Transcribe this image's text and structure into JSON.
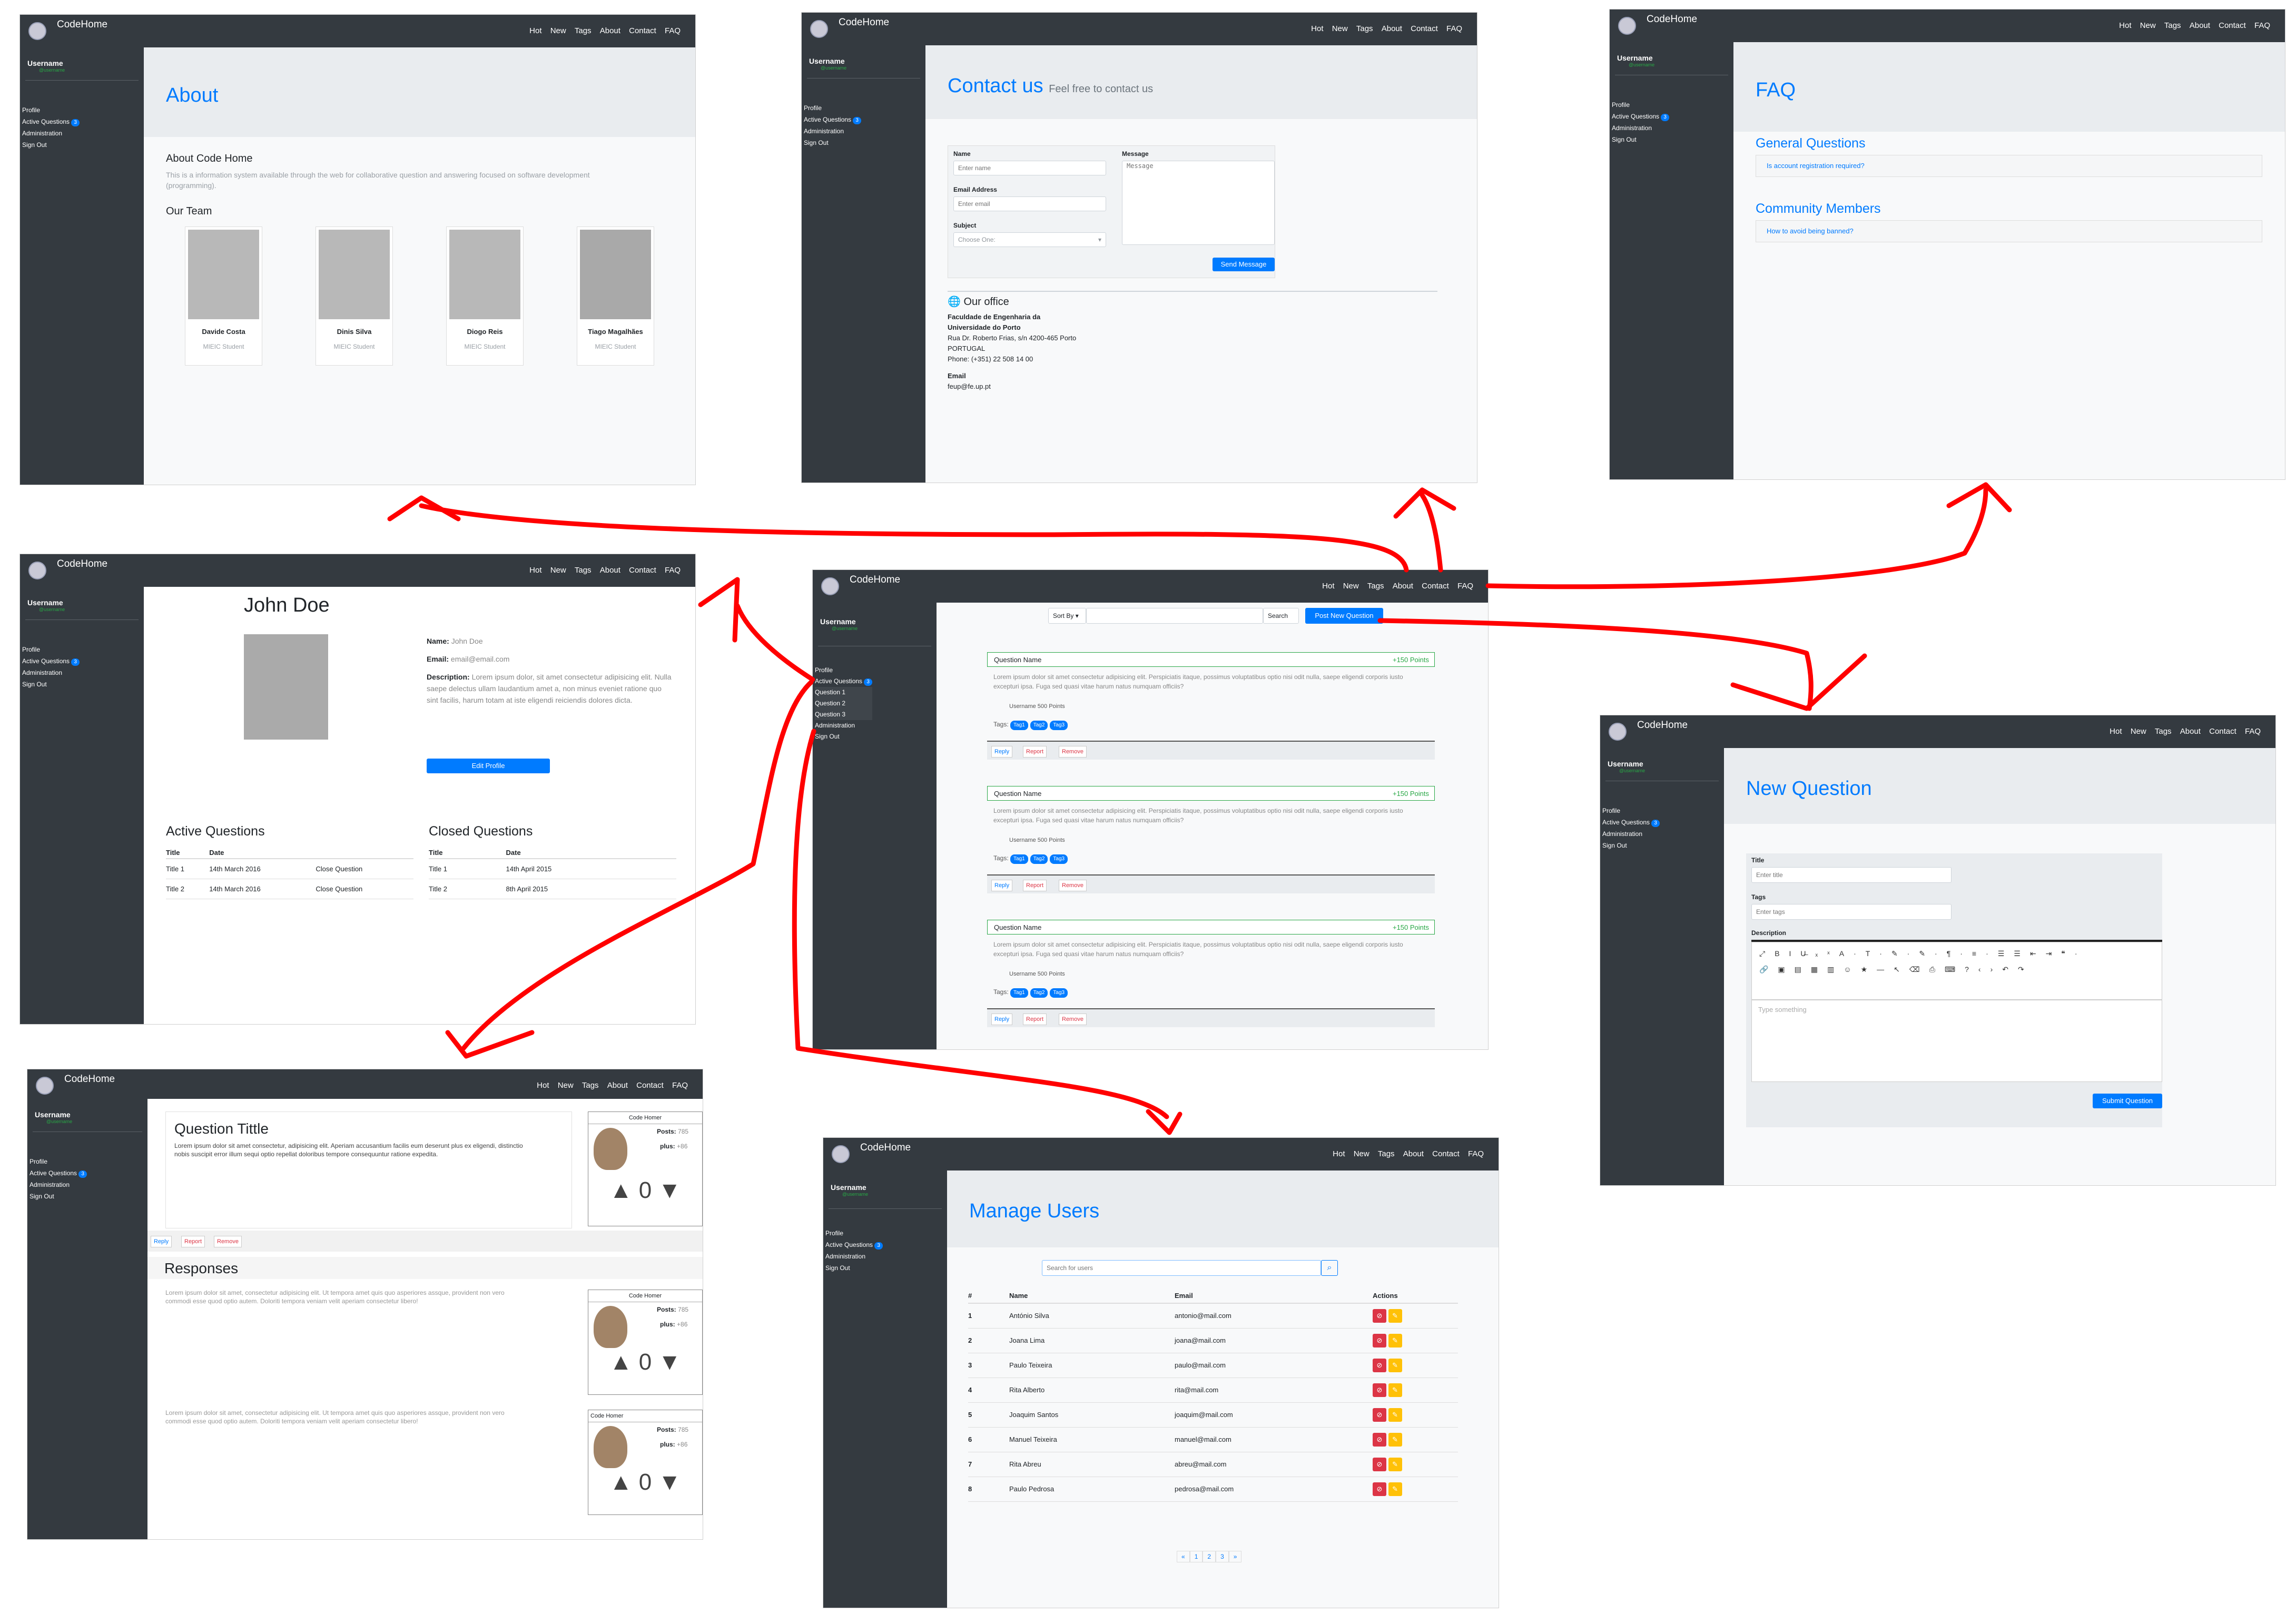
{
  "colors": {
    "accent": "#007bff",
    "dark": "#343a40",
    "hero": "#e9ecef",
    "success": "#28a745",
    "danger": "#dc3545",
    "warning": "#ffc107",
    "arrow": "#ff0000"
  },
  "nav": {
    "brand": "CodeHome",
    "links": [
      "Hot",
      "New",
      "Tags",
      "About",
      "Contact",
      "FAQ"
    ]
  },
  "sidebar": {
    "username": "Username",
    "sub": "@username",
    "items": [
      "Profile",
      "Active Questions",
      "Administration",
      "Sign Out"
    ],
    "badge": "3"
  },
  "about": {
    "title": "About",
    "section": "About Code Home",
    "description": "This is a information system available through the web for collaborative question and answering focused on software development (programming).",
    "team_title": "Our Team",
    "team": [
      {
        "name": "Davide Costa",
        "role": "MIEIC Student"
      },
      {
        "name": "Dinis Silva",
        "role": "MIEIC Student"
      },
      {
        "name": "Diogo Reis",
        "role": "MIEIC Student"
      },
      {
        "name": "Tiago Magalhães",
        "role": "MIEIC Student"
      }
    ]
  },
  "contact": {
    "title": "Contact us",
    "subtitle": "Feel free to contact us",
    "name_label": "Name",
    "name_ph": "Enter name",
    "email_label": "Email Address",
    "email_ph": "Enter email",
    "subject_label": "Subject",
    "subject_value": "Choose One:",
    "message_label": "Message",
    "message_ph": "Message",
    "send": "Send Message",
    "office": "Our office",
    "office_lines": [
      "Faculdade de Engenharia da",
      "Universidade do Porto",
      "Rua Dr. Roberto Frias, s/n 4200-465 Porto",
      "PORTUGAL",
      "Phone: (+351) 22 508 14 00"
    ],
    "email_title": "Email",
    "email_value": "feup@fe.up.pt"
  },
  "faq": {
    "title": "FAQ",
    "groups": [
      {
        "title": "General Questions",
        "item": "Is account registration required?"
      },
      {
        "title": "Community Members",
        "item": "How to avoid being banned?"
      }
    ]
  },
  "profile": {
    "name": "John Doe",
    "name_label": "Name:",
    "name_value": "John Doe",
    "email_label": "Email:",
    "email_value": "email@email.com",
    "desc_label": "Description:",
    "desc_value": "Lorem ipsum dolor, sit amet consectetur adipisicing elit. Nulla saepe delectus ullam laudantium amet a, non minus eveniet ratione quo sint facilis, harum totam at iste eligendi reiciendis dolores dicta.",
    "edit": "Edit Profile",
    "active_title": "Active Questions",
    "closed_title": "Closed Questions",
    "active_headers": [
      "Title",
      "Date",
      ""
    ],
    "active_rows": [
      [
        "Title 1",
        "14th March 2016",
        "Close Question"
      ],
      [
        "Title 2",
        "14th March 2016",
        "Close Question"
      ]
    ],
    "closed_headers": [
      "Title",
      "Date"
    ],
    "closed_rows": [
      [
        "Title 1",
        "14th April 2015"
      ],
      [
        "Title 2",
        "8th April 2015"
      ]
    ]
  },
  "home": {
    "sort": "Sort By",
    "search": "Search",
    "post": "Post New Question",
    "questions": [
      {
        "name": "Question Name",
        "points": "150 Points"
      },
      {
        "name": "Question Name",
        "points": "150 Points"
      },
      {
        "name": "Question Name",
        "points": "150 Points"
      }
    ],
    "body": "Lorem ipsum dolor sit amet consectetur adipisicing elit. Perspiciatis itaque, possimus voluptatibus optio nisi odit nulla, saepe eligendi corporis iusto excepturi ipsa. Fuga sed quasi vitae harum natus numquam officiis?",
    "user": "Username 500 Points",
    "tags_label": "Tags:",
    "tags": [
      "Tag1",
      "Tag2",
      "Tag3"
    ],
    "reply": "Reply",
    "report": "Report",
    "remove": "Remove",
    "side_questions": [
      "Question 1",
      "Question 2",
      "Question 3"
    ]
  },
  "newq": {
    "title": "New Question",
    "title_label": "Title",
    "title_ph": "Enter title",
    "tags_label": "Tags",
    "tags_ph": "Enter tags",
    "desc_label": "Description",
    "editor_ph": "Type something",
    "submit": "Submit Question"
  },
  "question": {
    "title": "Question Tittle",
    "body": "Lorem ipsum dolor sit amet consectetur, adipisicing elit. Aperiam accusantium facilis eum deserunt plus ex eligendi, distinctio nobis suscipit error illum sequi optio repellat doloribus tempore consequuntur ratione expedita.",
    "author": "Code Homer",
    "posts_label": "Posts:",
    "posts": "785",
    "plus_label": "plus:",
    "plus": "+86",
    "votes": "0",
    "reply": "Reply",
    "report": "Report",
    "remove": "Remove",
    "responses": "Responses",
    "response_body": "Lorem ipsum dolor sit amet, consectetur adipisicing elit. Ut tempora amet quis quo asperiores assque, provident non vero commodi esse quod optio autem. Doloriti tempora veniam velit aperiam consectetur libero!"
  },
  "users": {
    "title": "Manage Users",
    "search_ph": "Search for users",
    "headers": [
      "#",
      "Name",
      "Email",
      "Actions"
    ],
    "rows": [
      [
        "1",
        "António Silva",
        "antonio@mail.com"
      ],
      [
        "2",
        "Joana Lima",
        "joana@mail.com"
      ],
      [
        "3",
        "Paulo Teixeira",
        "paulo@mail.com"
      ],
      [
        "4",
        "Rita Alberto",
        "rita@mail.com"
      ],
      [
        "5",
        "Joaquim Santos",
        "joaquim@mail.com"
      ],
      [
        "6",
        "Manuel Teixeira",
        "manuel@mail.com"
      ],
      [
        "7",
        "Rita Abreu",
        "abreu@mail.com"
      ],
      [
        "8",
        "Paulo Pedrosa",
        "pedrosa@mail.com"
      ]
    ],
    "pages": [
      "«",
      "1",
      "2",
      "3",
      "»"
    ]
  }
}
